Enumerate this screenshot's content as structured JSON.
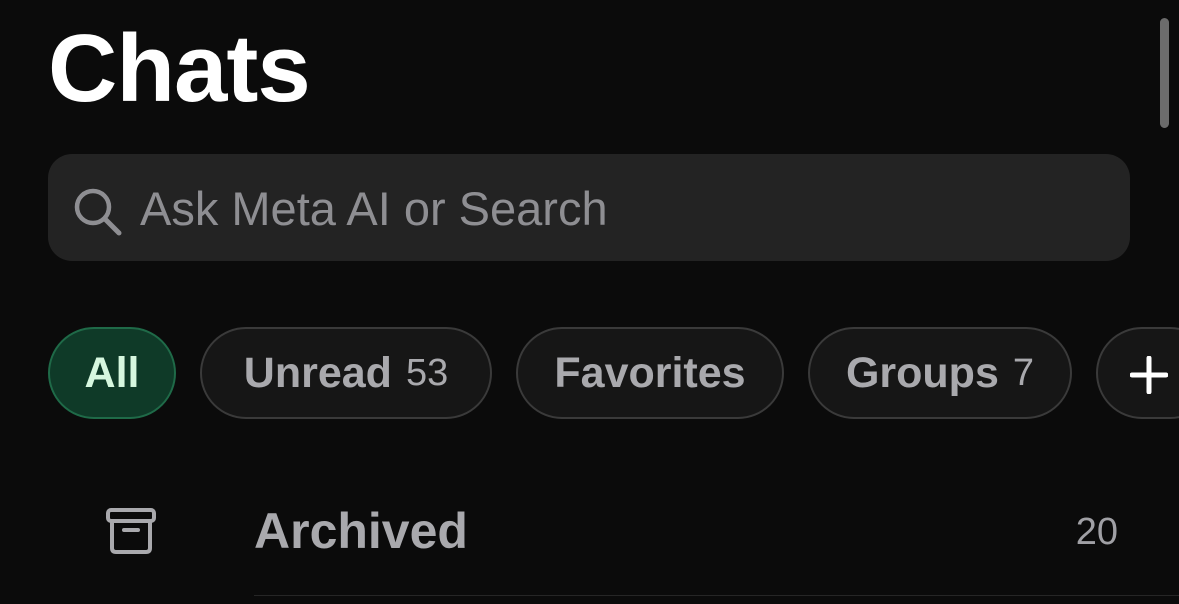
{
  "header": {
    "title": "Chats"
  },
  "search": {
    "placeholder": "Ask Meta AI or Search",
    "icon": "search-icon"
  },
  "filters": {
    "all": {
      "label": "All",
      "active": true
    },
    "unread": {
      "label": "Unread",
      "count": "53"
    },
    "favorites": {
      "label": "Favorites"
    },
    "groups": {
      "label": "Groups",
      "count": "7"
    },
    "add_icon": "plus-icon"
  },
  "archived": {
    "icon": "archive-icon",
    "label": "Archived",
    "count": "20"
  },
  "colors": {
    "background": "#0b0b0b",
    "search_bg": "#232323",
    "chip_active_bg": "#0f3a28",
    "chip_active_border": "#1f6a48",
    "chip_active_text": "#d6f7df",
    "muted_text": "#a9a9ad"
  }
}
